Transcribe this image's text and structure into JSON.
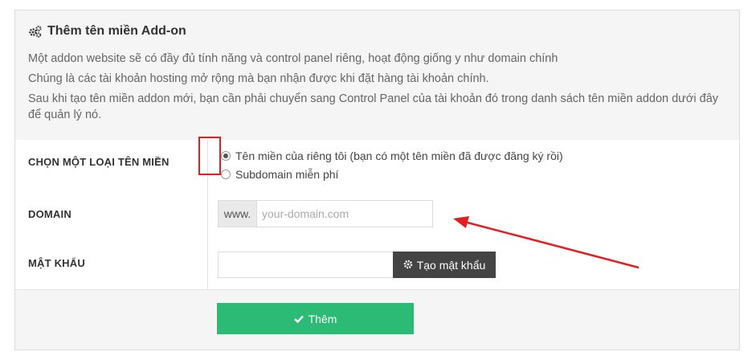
{
  "header": {
    "title": "Thêm tên miền Add-on",
    "descriptions": [
      "Một addon website sẽ có đầy đủ tính năng và control panel riêng, hoạt động giống y như domain chính",
      "Chúng là các tài khoản hosting mở rộng mà bạn nhận được khi đặt hàng tài khoản chính.",
      "Sau khi tạo tên miền addon mới, bạn cần phải chuyển sang Control Panel của tài khoản đó trong danh sách tên miền addon dưới đây để quản lý nó."
    ]
  },
  "domain_type": {
    "label": "CHỌN MỘT LOẠI TÊN MIỀN",
    "options": [
      {
        "label": "Tên miền của riêng tôi (bạn có một tên miền đã được đăng ký rồi)",
        "selected": true
      },
      {
        "label": "Subdomain miễn phí",
        "selected": false
      }
    ]
  },
  "domain": {
    "label": "DOMAIN",
    "prefix": "www.",
    "placeholder": "your-domain.com",
    "value": ""
  },
  "password": {
    "label": "MẬT KHẨU",
    "value": "",
    "generate_label": "Tạo mật khẩu"
  },
  "submit_label": "Thêm",
  "colors": {
    "submit_bg": "#2bbb74",
    "generate_bg": "#444444",
    "annotation_red": "#e02020"
  },
  "icons": {
    "title_icon": "gears-icon",
    "generate_icon": "gear-icon",
    "submit_icon": "check-icon"
  }
}
